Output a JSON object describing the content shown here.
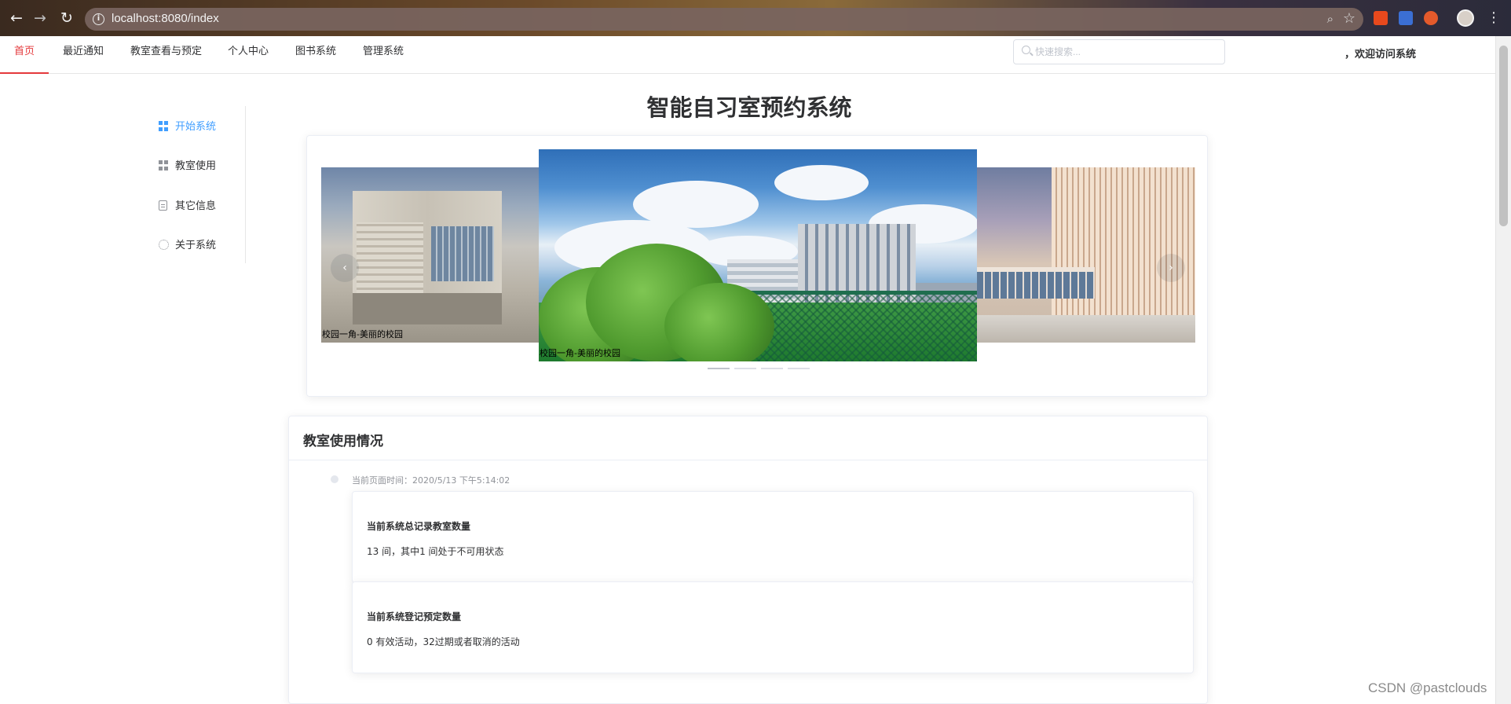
{
  "browser": {
    "url": "localhost:8080/index",
    "back_icon": "←",
    "forward_icon": "→",
    "reload_icon": "↻",
    "info_icon": "i",
    "zoom_icon": "⌕",
    "star_icon": "☆",
    "menu_icon": "⋮"
  },
  "topnav": {
    "items": [
      {
        "label": "首页",
        "active": true
      },
      {
        "label": "最近通知",
        "active": false
      },
      {
        "label": "教室查看与预定",
        "active": false
      },
      {
        "label": "个人中心",
        "active": false
      },
      {
        "label": "图书系统",
        "active": false
      },
      {
        "label": "管理系统",
        "active": false
      }
    ],
    "search_placeholder": "快速搜索...",
    "welcome": "，欢迎访问系统",
    "accent": "#e4393c"
  },
  "sidebar": {
    "items": [
      {
        "label": "开始系统",
        "icon": "grid-icon",
        "active": true
      },
      {
        "label": "教室使用",
        "icon": "grid-icon",
        "active": false
      },
      {
        "label": "其它信息",
        "icon": "document-icon",
        "active": false
      },
      {
        "label": "关于系统",
        "icon": "gear-icon",
        "active": false
      }
    ],
    "active_color": "#409eff"
  },
  "page": {
    "title": "智能自习室预约系统"
  },
  "carousel": {
    "slides": [
      {
        "caption": "校园一角-美丽的校园"
      },
      {
        "caption": "校园一角-美丽的校园"
      },
      {
        "caption": ""
      }
    ],
    "prev_icon": "‹",
    "next_icon": "›",
    "indicator_count": 4,
    "active_index": 0
  },
  "usage": {
    "title": "教室使用情况",
    "timestamp": "当前页面时间：2020/5/13 下午5:14:02",
    "stats": [
      {
        "title": "当前系统总记录教室数量",
        "detail": "13 间，其中1 间处于不可用状态"
      },
      {
        "title": "当前系统登记预定数量",
        "detail": "0 有效活动，32过期或者取消的活动"
      }
    ]
  },
  "watermark": "CSDN @pastclouds"
}
